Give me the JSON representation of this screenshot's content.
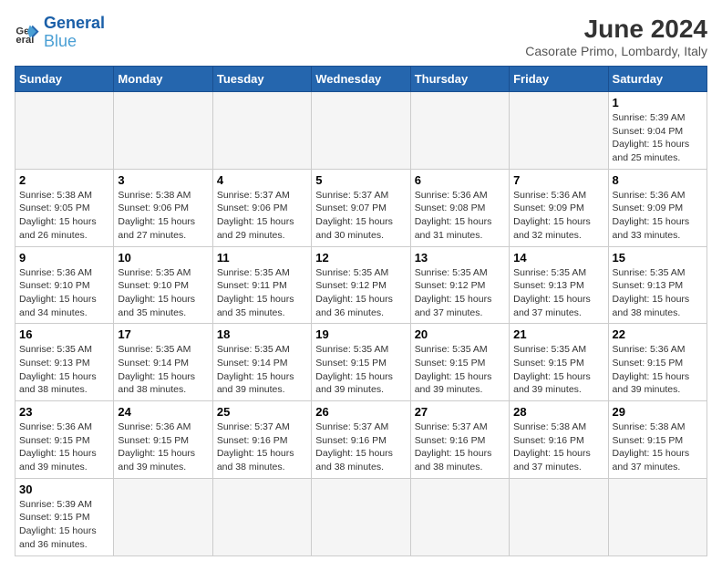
{
  "header": {
    "logo_general": "General",
    "logo_blue": "Blue",
    "title": "June 2024",
    "subtitle": "Casorate Primo, Lombardy, Italy"
  },
  "days_of_week": [
    "Sunday",
    "Monday",
    "Tuesday",
    "Wednesday",
    "Thursday",
    "Friday",
    "Saturday"
  ],
  "weeks": [
    [
      {
        "day": "",
        "info": "",
        "empty": true
      },
      {
        "day": "",
        "info": "",
        "empty": true
      },
      {
        "day": "",
        "info": "",
        "empty": true
      },
      {
        "day": "",
        "info": "",
        "empty": true
      },
      {
        "day": "",
        "info": "",
        "empty": true
      },
      {
        "day": "",
        "info": "",
        "empty": true
      },
      {
        "day": "1",
        "info": "Sunrise: 5:39 AM\nSunset: 9:04 PM\nDaylight: 15 hours\nand 25 minutes."
      }
    ],
    [
      {
        "day": "2",
        "info": "Sunrise: 5:38 AM\nSunset: 9:05 PM\nDaylight: 15 hours\nand 26 minutes."
      },
      {
        "day": "3",
        "info": "Sunrise: 5:38 AM\nSunset: 9:06 PM\nDaylight: 15 hours\nand 27 minutes."
      },
      {
        "day": "4",
        "info": "Sunrise: 5:37 AM\nSunset: 9:06 PM\nDaylight: 15 hours\nand 29 minutes."
      },
      {
        "day": "5",
        "info": "Sunrise: 5:37 AM\nSunset: 9:07 PM\nDaylight: 15 hours\nand 30 minutes."
      },
      {
        "day": "6",
        "info": "Sunrise: 5:36 AM\nSunset: 9:08 PM\nDaylight: 15 hours\nand 31 minutes."
      },
      {
        "day": "7",
        "info": "Sunrise: 5:36 AM\nSunset: 9:09 PM\nDaylight: 15 hours\nand 32 minutes."
      },
      {
        "day": "8",
        "info": "Sunrise: 5:36 AM\nSunset: 9:09 PM\nDaylight: 15 hours\nand 33 minutes."
      }
    ],
    [
      {
        "day": "9",
        "info": "Sunrise: 5:36 AM\nSunset: 9:10 PM\nDaylight: 15 hours\nand 34 minutes."
      },
      {
        "day": "10",
        "info": "Sunrise: 5:35 AM\nSunset: 9:10 PM\nDaylight: 15 hours\nand 35 minutes."
      },
      {
        "day": "11",
        "info": "Sunrise: 5:35 AM\nSunset: 9:11 PM\nDaylight: 15 hours\nand 35 minutes."
      },
      {
        "day": "12",
        "info": "Sunrise: 5:35 AM\nSunset: 9:12 PM\nDaylight: 15 hours\nand 36 minutes."
      },
      {
        "day": "13",
        "info": "Sunrise: 5:35 AM\nSunset: 9:12 PM\nDaylight: 15 hours\nand 37 minutes."
      },
      {
        "day": "14",
        "info": "Sunrise: 5:35 AM\nSunset: 9:13 PM\nDaylight: 15 hours\nand 37 minutes."
      },
      {
        "day": "15",
        "info": "Sunrise: 5:35 AM\nSunset: 9:13 PM\nDaylight: 15 hours\nand 38 minutes."
      }
    ],
    [
      {
        "day": "16",
        "info": "Sunrise: 5:35 AM\nSunset: 9:13 PM\nDaylight: 15 hours\nand 38 minutes."
      },
      {
        "day": "17",
        "info": "Sunrise: 5:35 AM\nSunset: 9:14 PM\nDaylight: 15 hours\nand 38 minutes."
      },
      {
        "day": "18",
        "info": "Sunrise: 5:35 AM\nSunset: 9:14 PM\nDaylight: 15 hours\nand 39 minutes."
      },
      {
        "day": "19",
        "info": "Sunrise: 5:35 AM\nSunset: 9:15 PM\nDaylight: 15 hours\nand 39 minutes."
      },
      {
        "day": "20",
        "info": "Sunrise: 5:35 AM\nSunset: 9:15 PM\nDaylight: 15 hours\nand 39 minutes."
      },
      {
        "day": "21",
        "info": "Sunrise: 5:35 AM\nSunset: 9:15 PM\nDaylight: 15 hours\nand 39 minutes."
      },
      {
        "day": "22",
        "info": "Sunrise: 5:36 AM\nSunset: 9:15 PM\nDaylight: 15 hours\nand 39 minutes."
      }
    ],
    [
      {
        "day": "23",
        "info": "Sunrise: 5:36 AM\nSunset: 9:15 PM\nDaylight: 15 hours\nand 39 minutes."
      },
      {
        "day": "24",
        "info": "Sunrise: 5:36 AM\nSunset: 9:15 PM\nDaylight: 15 hours\nand 39 minutes."
      },
      {
        "day": "25",
        "info": "Sunrise: 5:37 AM\nSunset: 9:16 PM\nDaylight: 15 hours\nand 38 minutes."
      },
      {
        "day": "26",
        "info": "Sunrise: 5:37 AM\nSunset: 9:16 PM\nDaylight: 15 hours\nand 38 minutes."
      },
      {
        "day": "27",
        "info": "Sunrise: 5:37 AM\nSunset: 9:16 PM\nDaylight: 15 hours\nand 38 minutes."
      },
      {
        "day": "28",
        "info": "Sunrise: 5:38 AM\nSunset: 9:16 PM\nDaylight: 15 hours\nand 37 minutes."
      },
      {
        "day": "29",
        "info": "Sunrise: 5:38 AM\nSunset: 9:15 PM\nDaylight: 15 hours\nand 37 minutes."
      }
    ],
    [
      {
        "day": "30",
        "info": "Sunrise: 5:39 AM\nSunset: 9:15 PM\nDaylight: 15 hours\nand 36 minutes."
      },
      {
        "day": "",
        "info": "",
        "empty": true
      },
      {
        "day": "",
        "info": "",
        "empty": true
      },
      {
        "day": "",
        "info": "",
        "empty": true
      },
      {
        "day": "",
        "info": "",
        "empty": true
      },
      {
        "day": "",
        "info": "",
        "empty": true
      },
      {
        "day": "",
        "info": "",
        "empty": true
      }
    ]
  ]
}
